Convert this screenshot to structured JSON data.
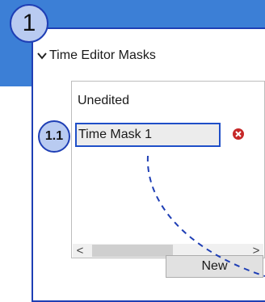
{
  "callouts": {
    "main": "1",
    "item": "1.1"
  },
  "panel": {
    "title": "Time Editor Masks",
    "chevron_icon": "chevron-down-icon",
    "list_label": "Unedited",
    "items": [
      {
        "label": "Time Mask 1",
        "remove_icon": "remove-x-icon"
      }
    ],
    "scrollbar": {
      "left_arrow": "<",
      "right_arrow": ">"
    },
    "new_button": "New"
  },
  "colors": {
    "header_band": "#3c7fd6",
    "callout_fill": "#b9cbf1",
    "callout_border": "#1f3fb5",
    "remove_icon": "#c62828"
  }
}
